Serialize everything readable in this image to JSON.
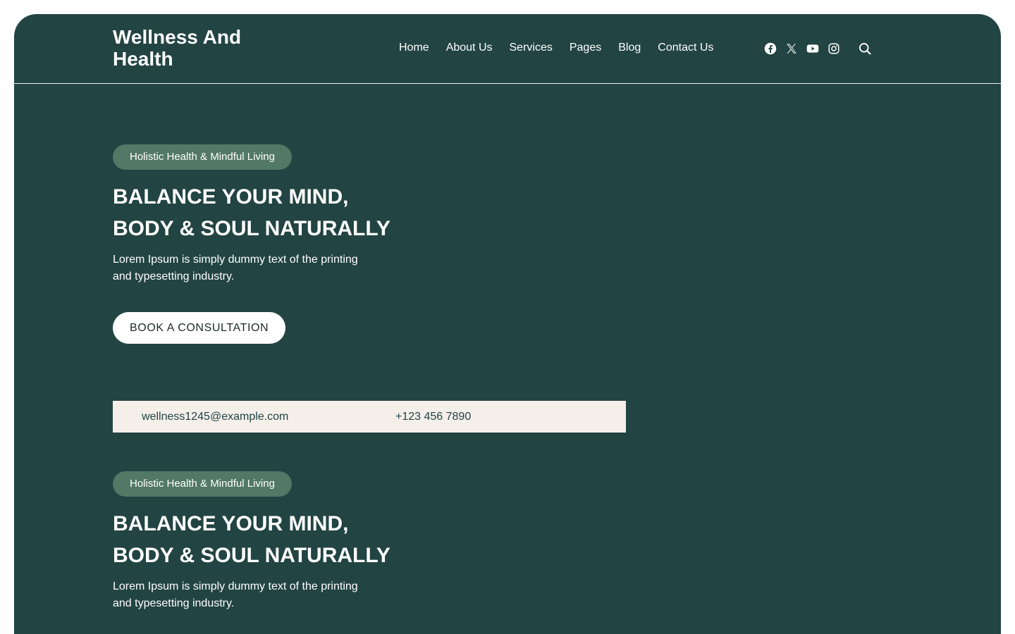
{
  "header": {
    "logo": "Wellness And Health",
    "nav": [
      "Home",
      "About Us",
      "Services",
      "Pages",
      "Blog",
      "Contact Us"
    ],
    "social_icons": [
      "facebook-icon",
      "x-icon",
      "youtube-icon",
      "instagram-icon"
    ],
    "search_icon": "search-icon"
  },
  "hero": {
    "badge": "Holistic Health & Mindful Living",
    "title_line1": "BALANCE YOUR MIND,",
    "title_line2": "BODY & SOUL NATURALLY",
    "text": "Lorem Ipsum is simply dummy text of the printing and typesetting industry.",
    "cta_label": "BOOK A CONSULTATION"
  },
  "contact": {
    "email": "wellness1245@example.com",
    "phone": "+123 456 7890"
  },
  "hero_repeat": {
    "badge": "Holistic Health & Mindful Living",
    "title_line1": "BALANCE YOUR MIND,",
    "title_line2": "BODY & SOUL NATURALLY",
    "text": "Lorem Ipsum is simply dummy text of the printing and typesetting industry."
  },
  "colors": {
    "background": "#224443",
    "badge": "#527866",
    "contact_bar": "#f4efe9",
    "text": "#ffffff"
  }
}
